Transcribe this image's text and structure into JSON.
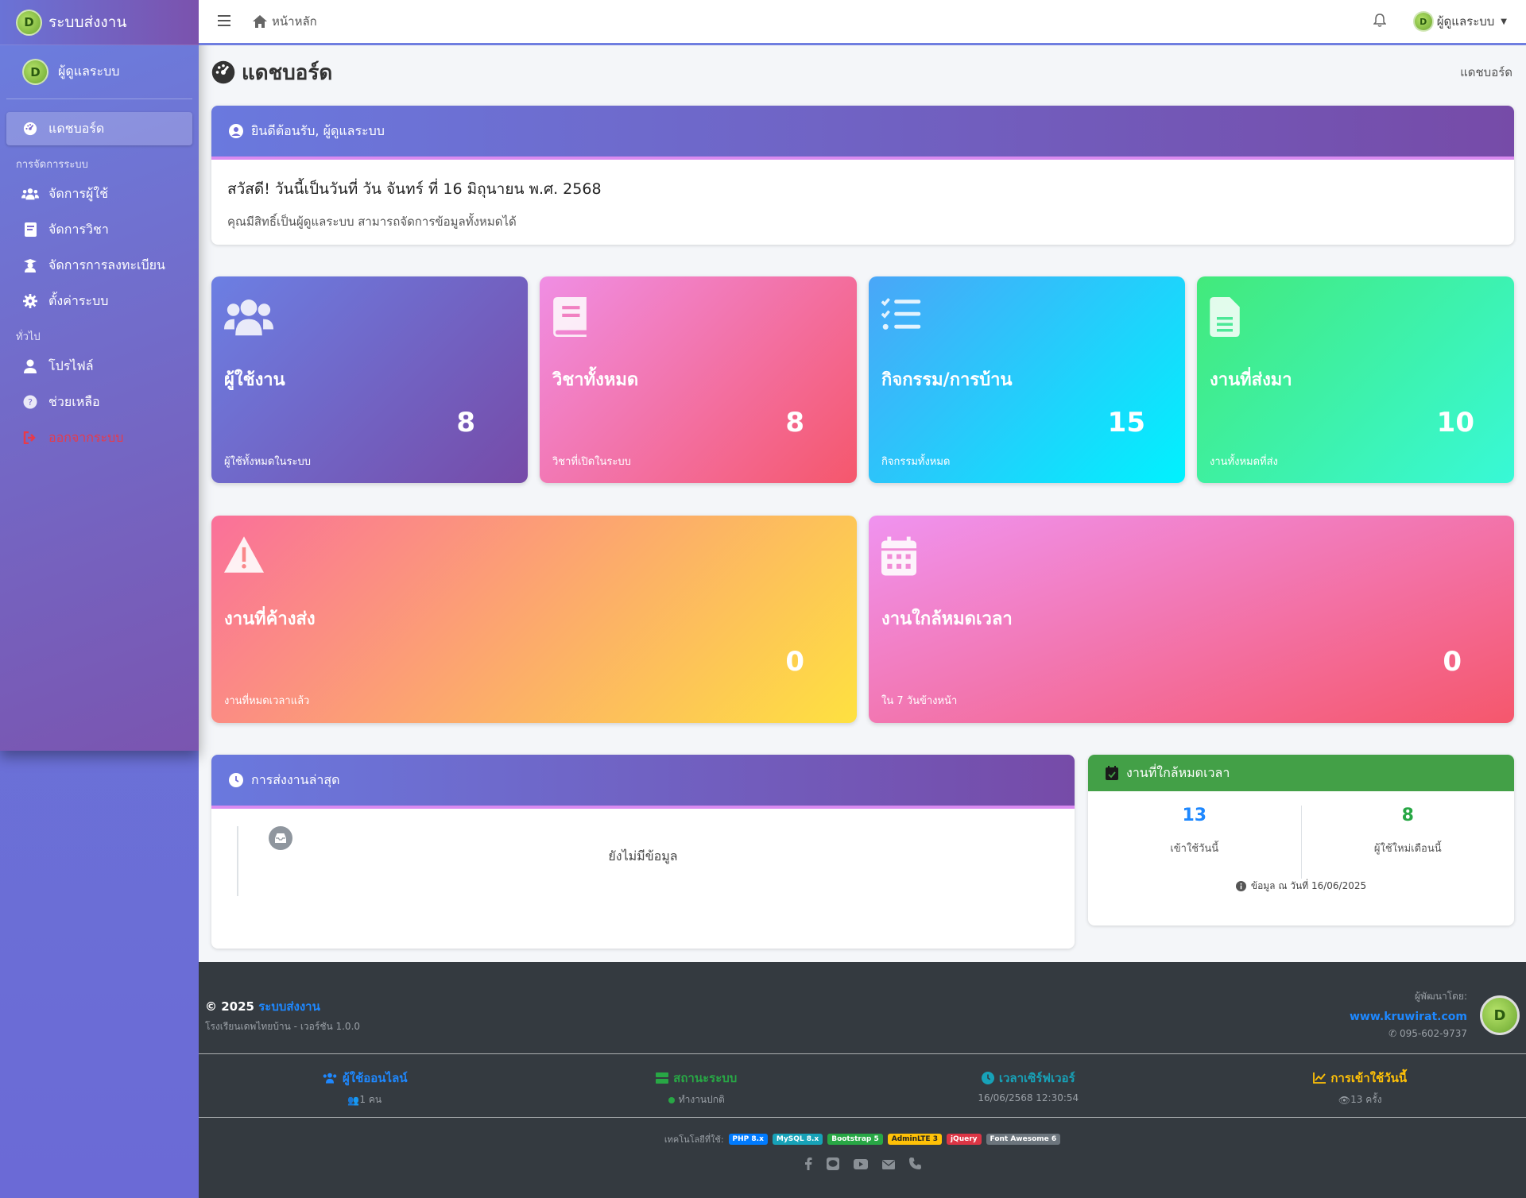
{
  "brand": {
    "title": "ระบบส่งงาน",
    "logo_letter": "D"
  },
  "user_panel": {
    "name": "ผู้ดูแลระบบ"
  },
  "sidebar": {
    "items": [
      {
        "label": "แดชบอร์ด",
        "icon": "gauge-icon"
      },
      {
        "label": "จัดการผู้ใช้",
        "icon": "users-icon"
      },
      {
        "label": "จัดการวิชา",
        "icon": "book-icon"
      },
      {
        "label": "จัดการการลงทะเบียน",
        "icon": "graduate-icon"
      },
      {
        "label": "ตั้งค่าระบบ",
        "icon": "gear-icon"
      },
      {
        "label": "โปรไฟล์",
        "icon": "user-icon"
      },
      {
        "label": "ช่วยเหลือ",
        "icon": "question-icon"
      },
      {
        "label": "ออกจากระบบ",
        "icon": "logout-icon"
      }
    ],
    "headers": [
      "การจัดการระบบ",
      "ทั่วไป"
    ]
  },
  "topbar": {
    "home_label": "หน้าหลัก",
    "user_label": "ผู้ดูแลระบบ"
  },
  "page": {
    "title": "แดชบอร์ด",
    "breadcrumb": "แดชบอร์ด"
  },
  "welcome": {
    "heading": "ยินดีต้อนรับ, ผู้ดูแลระบบ",
    "line1": "สวัสดี! วันนี้เป็นวันที่ วัน จันทร์ ที่ 16 มิถุนายน พ.ศ. 2568",
    "line2": "คุณมีสิทธิ์เป็นผู้ดูแลระบบ สามารถจัดการข้อมูลทั้งหมดได้"
  },
  "stats": [
    {
      "title": "ผู้ใช้งาน",
      "value": "8",
      "sub": "ผู้ใช้ทั้งหมดในระบบ",
      "icon": "users-icon"
    },
    {
      "title": "วิชาทั้งหมด",
      "value": "8",
      "sub": "วิชาที่เปิดในระบบ",
      "icon": "book-icon"
    },
    {
      "title": "กิจกรรม/การบ้าน",
      "value": "15",
      "sub": "กิจกรรมทั้งหมด",
      "icon": "tasks-icon"
    },
    {
      "title": "งานที่ส่งมา",
      "value": "10",
      "sub": "งานทั้งหมดที่ส่ง",
      "icon": "file-icon"
    },
    {
      "title": "งานที่ค้างส่ง",
      "value": "0",
      "sub": "งานที่หมดเวลาแล้ว",
      "icon": "warning-icon"
    },
    {
      "title": "งานใกล้หมดเวลา",
      "value": "0",
      "sub": "ใน 7 วันข้างหน้า",
      "icon": "calendar-icon"
    }
  ],
  "recent": {
    "heading": "การส่งงานล่าสุด",
    "empty": "ยังไม่มีข้อมูล"
  },
  "near": {
    "heading": "งานที่ใกล้หมดเวลา",
    "stat1": {
      "value": "13",
      "label": "เข้าใช้วันนี้",
      "color": "#1e88ff"
    },
    "stat2": {
      "value": "8",
      "label": "ผู้ใช้ใหม่เดือนนี้",
      "color": "#28a745"
    },
    "foot": "ข้อมูล ณ วันที่ 16/06/2025"
  },
  "footer": {
    "copy_prefix": "© 2025",
    "copy_brand": "ระบบส่งงาน",
    "school": "โรงเรียนเดพไทยบ้าน - เวอร์ชัน 1.0.0",
    "dev_label": "ผู้พัฒนาโดย:",
    "dev_site": "www.kruwirat.com",
    "dev_phone": "095-602-9737",
    "mid": [
      {
        "title": "ผู้ใช้ออนไลน์",
        "sub": "1 คน",
        "color": "#1e88ff"
      },
      {
        "title": "สถานะระบบ",
        "sub": "ทำงานปกติ",
        "color": "#28a745"
      },
      {
        "title": "เวลาเซิร์ฟเวอร์",
        "sub": "16/06/2568 12:30:54",
        "color": "#17a2b8"
      },
      {
        "title": "การเข้าใช้วันนี้",
        "sub": "13 ครั้ง",
        "color": "#ffc107"
      }
    ],
    "tech_label": "เทคโนโลยีที่ใช้:",
    "tech": [
      {
        "name": "PHP 8.x",
        "color": "#007bff"
      },
      {
        "name": "MySQL 8.x",
        "color": "#17a2b8"
      },
      {
        "name": "Bootstrap 5",
        "color": "#28a745"
      },
      {
        "name": "AdminLTE 3",
        "color": "#ffc107"
      },
      {
        "name": "jQuery",
        "color": "#dc3545"
      },
      {
        "name": "Font Awesome 6",
        "color": "#6c757d"
      }
    ],
    "social": [
      "facebook-icon",
      "line-icon",
      "youtube-icon",
      "email-icon",
      "phone-icon"
    ]
  }
}
